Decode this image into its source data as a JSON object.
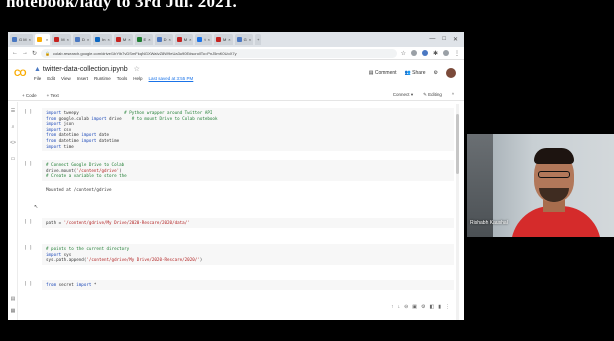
{
  "caption": "notebook/lady to 3rd Jul. 2021.",
  "browser": {
    "tabs": [
      {
        "label": "G M",
        "color": "#4a78c2"
      },
      {
        "label": "",
        "color": "#f9ab00"
      },
      {
        "label": "M",
        "color": "#c5221f"
      },
      {
        "label": "D",
        "color": "#4a78c2"
      },
      {
        "label": "In",
        "color": "#0a66c2"
      },
      {
        "label": "M",
        "color": "#c5221f"
      },
      {
        "label": "E",
        "color": "#1e7d32"
      },
      {
        "label": "D",
        "color": "#4a78c2"
      },
      {
        "label": "M",
        "color": "#c5221f"
      },
      {
        "label": "t",
        "color": "#1a73e8"
      },
      {
        "label": "M",
        "color": "#c5221f"
      },
      {
        "label": "G",
        "color": "#4a78c2"
      }
    ],
    "new_tab_label": "+",
    "url": "colab.research.google.com/drive/1bYlb7vDSmFkqNGXWaIvZ8W9eUa3u90E#scrollTo=PnJ5mK0UoX7y"
  },
  "colab": {
    "logo": "CO",
    "notebook_title": "twitter-data-collection.ipynb",
    "menus": [
      "File",
      "Edit",
      "View",
      "Insert",
      "Runtime",
      "Tools",
      "Help"
    ],
    "last_edit": "Last saved at 3:55 PM",
    "comment_label": "Comment",
    "share_label": "Share",
    "toolbar_code": "+ Code",
    "toolbar_text": "+ Text",
    "connect_label": "Connect",
    "editing_label": "Editing"
  },
  "cells": [
    {
      "run": "[ ]",
      "lines": [
        {
          "parts": [
            {
              "t": "import ",
              "c": "kw"
            },
            {
              "t": "tweepy                  ",
              "c": ""
            },
            {
              "t": "# Python wrapper around Twitter API",
              "c": "cm"
            }
          ]
        },
        {
          "parts": [
            {
              "t": "from ",
              "c": "kw"
            },
            {
              "t": "google.colab ",
              "c": ""
            },
            {
              "t": "import ",
              "c": "kw"
            },
            {
              "t": "drive    ",
              "c": ""
            },
            {
              "t": "# to mount Drive to Colab notebook",
              "c": "cm"
            }
          ]
        },
        {
          "parts": [
            {
              "t": "import ",
              "c": "kw"
            },
            {
              "t": "json",
              "c": ""
            }
          ]
        },
        {
          "parts": [
            {
              "t": "import ",
              "c": "kw"
            },
            {
              "t": "csv",
              "c": ""
            }
          ]
        },
        {
          "parts": [
            {
              "t": "from ",
              "c": "kw"
            },
            {
              "t": "datetime ",
              "c": ""
            },
            {
              "t": "import ",
              "c": "kw"
            },
            {
              "t": "date",
              "c": ""
            }
          ]
        },
        {
          "parts": [
            {
              "t": "from ",
              "c": "kw"
            },
            {
              "t": "datetime ",
              "c": ""
            },
            {
              "t": "import ",
              "c": "kw"
            },
            {
              "t": "datetime",
              "c": ""
            }
          ]
        },
        {
          "parts": [
            {
              "t": "import ",
              "c": "kw"
            },
            {
              "t": "time",
              "c": ""
            }
          ]
        }
      ]
    },
    {
      "run": "[ ]",
      "lines": [
        {
          "parts": [
            {
              "t": "# Connect Google Drive to Colab",
              "c": "cm"
            }
          ]
        },
        {
          "parts": [
            {
              "t": "drive.mount(",
              "c": ""
            },
            {
              "t": "'/content/gdrive'",
              "c": "str"
            },
            {
              "t": ")",
              "c": ""
            }
          ]
        },
        {
          "parts": [
            {
              "t": "# Create a variable to store the",
              "c": "cm"
            }
          ]
        }
      ],
      "output": "Mounted at /content/gdrive"
    },
    {
      "run": "[ ]",
      "lines": [
        {
          "parts": [
            {
              "t": "path = ",
              "c": ""
            },
            {
              "t": "'/content/gdrive/My Drive/2020-Rescare/2020/data/'",
              "c": "str"
            }
          ]
        }
      ]
    },
    {
      "run": "[ ]",
      "lines": [
        {
          "parts": [
            {
              "t": "# points to the current directory",
              "c": "cm"
            }
          ]
        },
        {
          "parts": [
            {
              "t": "import ",
              "c": "kw"
            },
            {
              "t": "sys",
              "c": ""
            }
          ]
        },
        {
          "parts": [
            {
              "t": "sys.path.append(",
              "c": ""
            },
            {
              "t": "'/content/gdrive/My Drive/2020-Rescare/2020/'",
              "c": "str"
            },
            {
              "t": ")",
              "c": ""
            }
          ]
        }
      ]
    },
    {
      "run": "[ ]",
      "lines": [
        {
          "parts": [
            {
              "t": "from ",
              "c": "kw"
            },
            {
              "t": "secret ",
              "c": ""
            },
            {
              "t": "import ",
              "c": "kw"
            },
            {
              "t": "*",
              "c": ""
            }
          ]
        }
      ]
    }
  ],
  "webcam": {
    "name": "Rishabh Kaushal"
  }
}
